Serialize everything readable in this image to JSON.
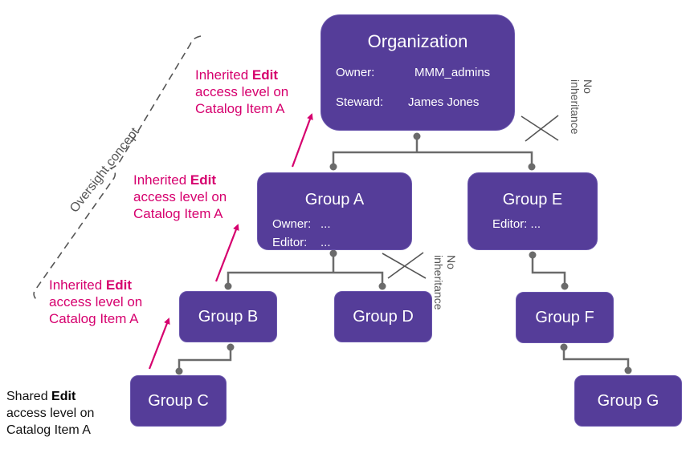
{
  "colors": {
    "node_fill": "#553d99",
    "node_text": "#ffffff",
    "connector": "#6b6b6b",
    "inherit_arrow": "#d6006e",
    "inherit_text": "#d6006e",
    "bracket": "#555555"
  },
  "nodes": {
    "organization": {
      "title": "Organization",
      "rows": [
        {
          "label": "Owner:",
          "value": "MMM_admins"
        },
        {
          "label": "Steward:",
          "value": "James Jones"
        }
      ]
    },
    "group_a": {
      "title": "Group A",
      "rows": [
        {
          "label": "Owner:",
          "value": "..."
        },
        {
          "label": "Editor:",
          "value": "..."
        }
      ]
    },
    "group_e": {
      "title": "Group E",
      "rows": [
        {
          "label": "Editor:",
          "value": "..."
        }
      ]
    },
    "group_b": {
      "title": "Group B"
    },
    "group_c": {
      "title": "Group C"
    },
    "group_d": {
      "title": "Group D"
    },
    "group_f": {
      "title": "Group F"
    },
    "group_g": {
      "title": "Group G"
    }
  },
  "annotations": {
    "inherited_org": {
      "prefix": "Inherited ",
      "bold": "Edit",
      "line2": "access level on",
      "line3": "Catalog Item A"
    },
    "inherited_group_a": {
      "prefix": "Inherited ",
      "bold": "Edit",
      "line2": "access level on",
      "line3": "Catalog Item A"
    },
    "inherited_group_b": {
      "prefix": "Inherited ",
      "bold": "Edit",
      "line2": "access level on",
      "line3": "Catalog Item A"
    },
    "shared_group_c": {
      "prefix": "Shared ",
      "bold": "Edit",
      "line2": "access level on",
      "line3": "Catalog Item A"
    },
    "no_inheritance_top": {
      "line1": "No",
      "line2": "inheritance"
    },
    "no_inheritance_mid": {
      "line1": "No",
      "line2": "inheritance"
    },
    "oversight": "Oversight concept"
  },
  "edges": [
    {
      "from": "organization",
      "to": "group_a"
    },
    {
      "from": "organization",
      "to": "group_e"
    },
    {
      "from": "group_a",
      "to": "group_b"
    },
    {
      "from": "group_a",
      "to": "group_d"
    },
    {
      "from": "group_b",
      "to": "group_c"
    },
    {
      "from": "group_e",
      "to": "group_f"
    },
    {
      "from": "group_f",
      "to": "group_g"
    }
  ]
}
